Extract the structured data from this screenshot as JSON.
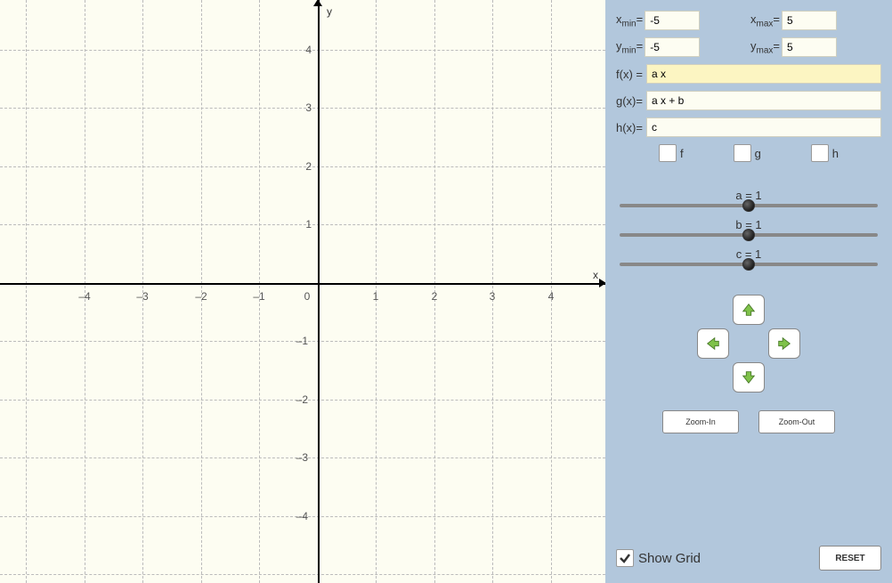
{
  "chart_data": {
    "type": "line",
    "title": "",
    "xlabel": "x",
    "ylabel": "y",
    "xlim": [
      -5,
      5
    ],
    "ylim": [
      -5,
      5
    ],
    "x_ticks": [
      -4,
      -3,
      -2,
      -1,
      0,
      1,
      2,
      3,
      4
    ],
    "y_ticks": [
      -4,
      -3,
      -2,
      -1,
      1,
      2,
      3,
      4
    ],
    "grid": true,
    "series": []
  },
  "panel": {
    "xmin_label": "x",
    "xmin_sub": "min",
    "xmin_value": "-5",
    "xmax_label": "x",
    "xmax_sub": "max",
    "xmax_value": "5",
    "ymin_label": "y",
    "ymin_sub": "min",
    "ymin_value": "-5",
    "ymax_label": "y",
    "ymax_sub": "max",
    "ymax_value": "5",
    "f_label": "f(x) =",
    "f_value": "a x",
    "g_label": "g(x)=",
    "g_value": "a x + b",
    "h_label": "h(x)=",
    "h_value": "c",
    "chk_f": "f",
    "chk_g": "g",
    "chk_h": "h",
    "slider_a": "a = 1",
    "slider_b": "b = 1",
    "slider_c": "c = 1",
    "zoom_in": "Zoom-In",
    "zoom_out": "Zoom-Out",
    "show_grid": "Show Grid",
    "show_grid_checked": true,
    "reset": "RESET"
  },
  "axis": {
    "x_label": "x",
    "y_label": "y"
  }
}
